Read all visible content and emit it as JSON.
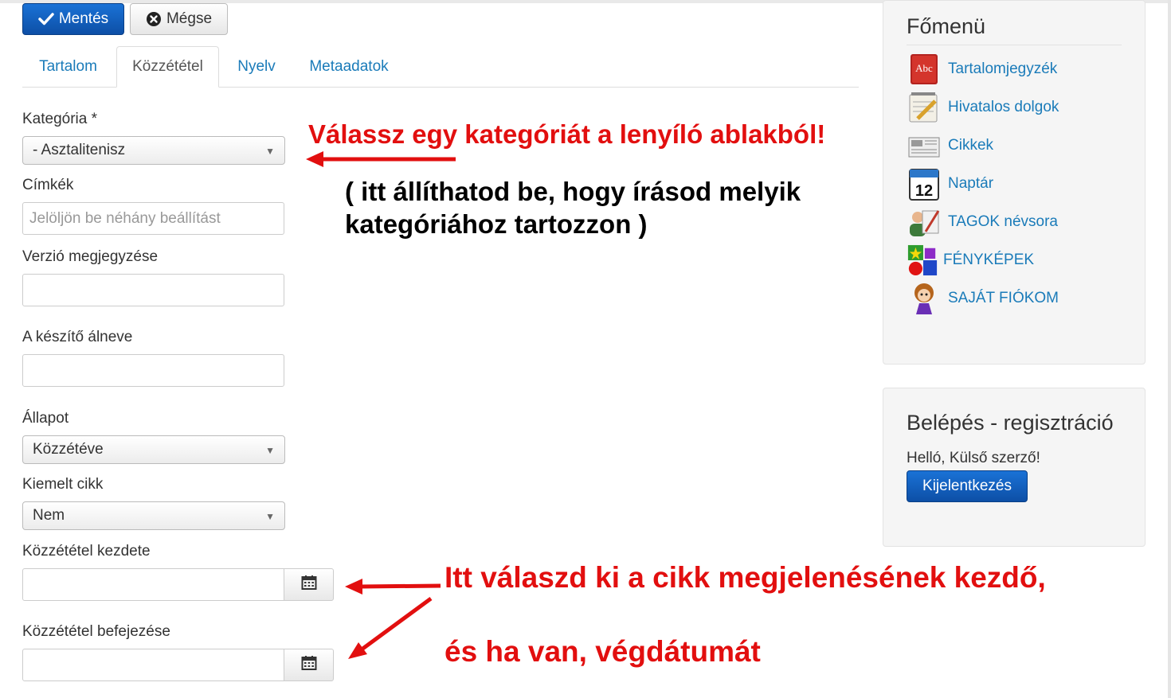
{
  "toolbar": {
    "save_label": "Mentés",
    "cancel_label": "Mégse"
  },
  "tabs": [
    {
      "label": "Tartalom",
      "active": false
    },
    {
      "label": "Közzététel",
      "active": true
    },
    {
      "label": "Nyelv",
      "active": false
    },
    {
      "label": "Metaadatok",
      "active": false
    }
  ],
  "form": {
    "category_label": "Kategória *",
    "category_value": "- Asztalitenisz",
    "tags_label": "Címkék",
    "tags_placeholder": "Jelöljön be néhány beállítást",
    "version_note_label": "Verzió megjegyzése",
    "version_note_value": "",
    "author_alias_label": "A készítő álneve",
    "author_alias_value": "",
    "status_label": "Állapot",
    "status_value": "Közzétéve",
    "featured_label": "Kiemelt cikk",
    "featured_value": "Nem",
    "publish_up_label": "Közzététel kezdete",
    "publish_up_value": "",
    "publish_down_label": "Közzététel befejezése",
    "publish_down_value": ""
  },
  "annotations": {
    "category_hint": "Válassz egy kategóriát a lenyíló ablakból!",
    "category_hint_line1": "( itt állíthatod be, hogy írásod melyik",
    "category_hint_line2": "kategóriához tartozzon )",
    "date_hint_line1": "Itt válaszd ki a cikk megjelenésének kezdő,",
    "date_hint_line2": "és ha van, végdátumát",
    "color": "#e20f0f"
  },
  "sidebar": {
    "main_menu_title": "Főmenü",
    "menu_items": [
      {
        "label": "Tartalomjegyzék",
        "icon": "abc-book-icon"
      },
      {
        "label": "Hivatalos dolgok",
        "icon": "notepad-pencil-icon"
      },
      {
        "label": "Cikkek",
        "icon": "newspaper-icon"
      },
      {
        "label": "Naptár",
        "icon": "calendar-icon",
        "icon_text": "12"
      },
      {
        "label": "TAGOK névsora",
        "icon": "members-icon"
      },
      {
        "label": "FÉNYKÉPEK",
        "icon": "shapes-icon"
      },
      {
        "label": "SAJÁT FIÓKOM",
        "icon": "girl-avatar-icon"
      }
    ],
    "login_title": "Belépés - regisztráció",
    "greeting": "Helló, Külső szerző!",
    "logout_label": "Kijelentkezés"
  },
  "colors": {
    "primary_button": "#1565c0",
    "link": "#1a7bb9",
    "annotation_red": "#e20f0f"
  }
}
